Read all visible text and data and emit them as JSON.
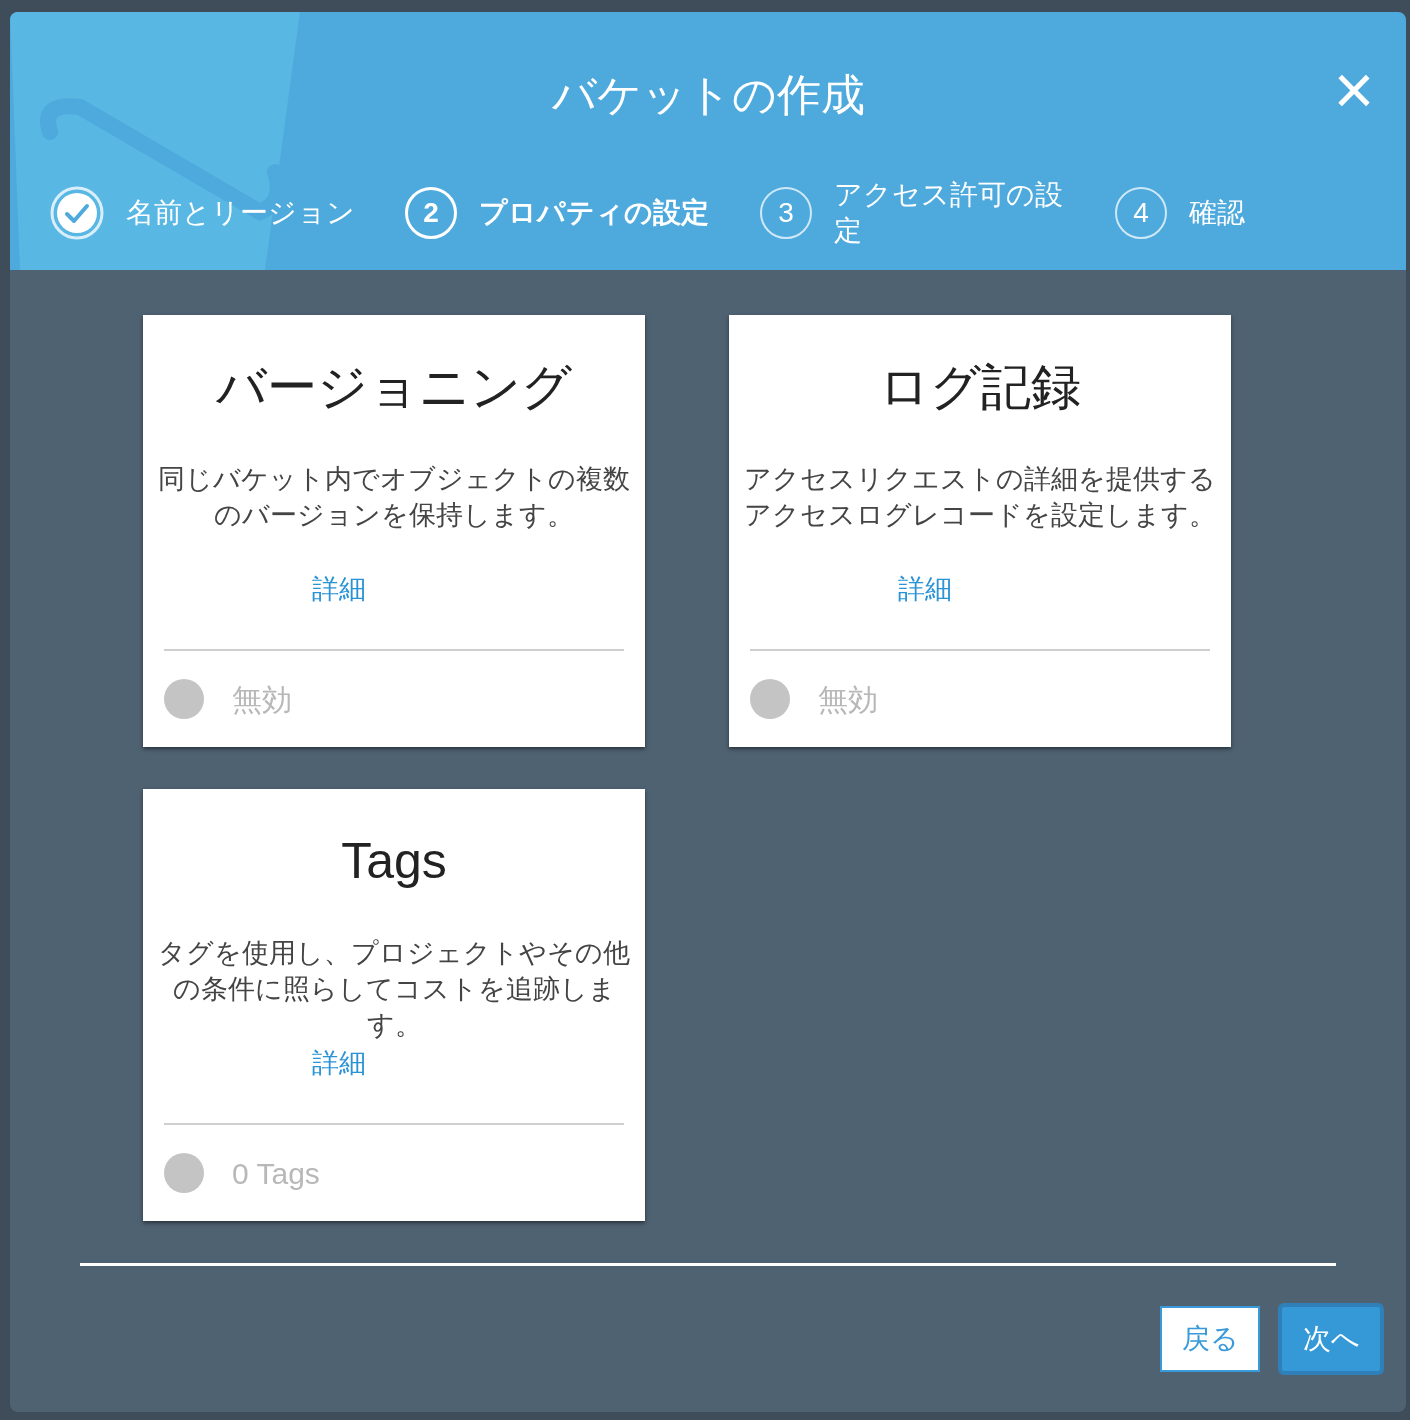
{
  "dialog": {
    "title": "バケットの作成",
    "close": "×"
  },
  "steps": [
    {
      "label": "名前とリージョン",
      "done": true,
      "selected": false
    },
    {
      "number": "2",
      "label": "プロパティの設定",
      "done": false,
      "selected": true
    },
    {
      "number": "3",
      "label": "アクセス許可の設定",
      "done": false,
      "selected": false
    },
    {
      "number": "4",
      "label": "確認",
      "done": false,
      "selected": false
    }
  ],
  "cards": [
    {
      "title": "バージョニング",
      "description": "同じバケット内でオブジェクトの複数のバージョンを保持します。",
      "link": "詳細",
      "on": false,
      "status": "無効"
    },
    {
      "title": "ログ記録",
      "description": "アクセスリクエストの詳細を提供するアクセスログレコードを設定します。",
      "link": "詳細",
      "on": false,
      "status": "無効"
    },
    {
      "title": "Tags",
      "description": "タグを使用し、プロジェクトやその他の条件に照らしてコストを追跡します。",
      "link": "詳細",
      "on": false,
      "status": "0 Tags"
    }
  ],
  "buttons": {
    "back": "戻る",
    "next": "次へ"
  }
}
